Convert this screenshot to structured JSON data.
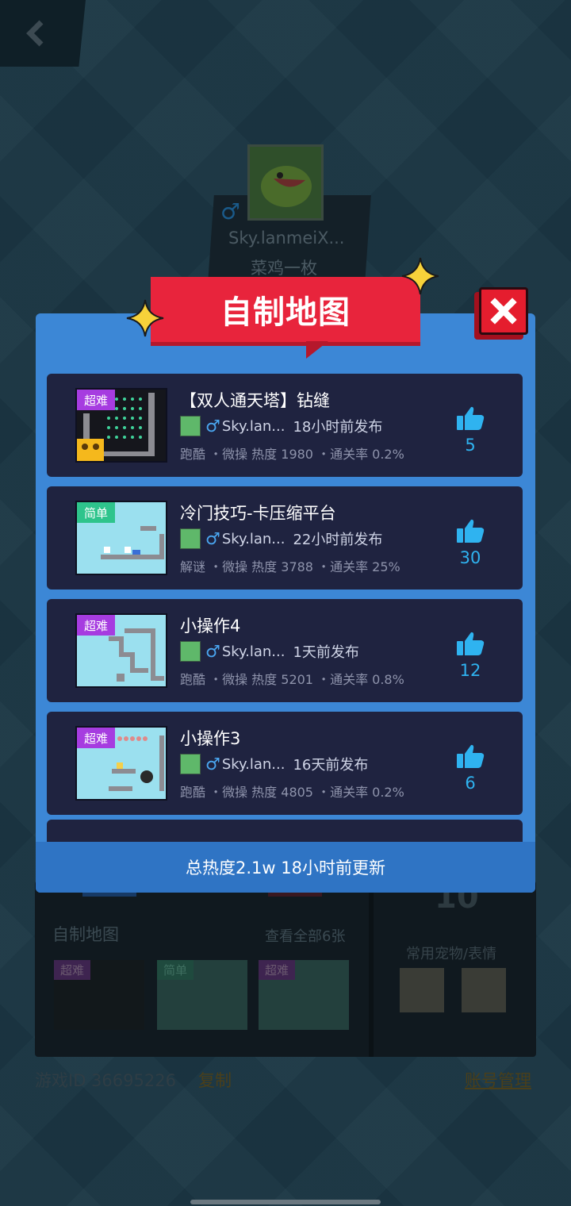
{
  "background": {
    "profile": {
      "gender": "♂",
      "name": "Sky.lanmeiX...",
      "title": "菜鸡一枚"
    },
    "custom_maps_section": {
      "title": "自制地图",
      "view_all": "查看全部6张",
      "thumbs": [
        {
          "badge": "超难"
        },
        {
          "badge": "简单"
        },
        {
          "badge": "超难"
        }
      ]
    },
    "big_number": "10",
    "pets_label": "常用宠物/表情",
    "game_id": "游戏ID 36695226",
    "copy_label": "复制",
    "account_label": "账号管理"
  },
  "modal": {
    "title": "自制地图",
    "footer": "总热度2.1w 18小时前更新",
    "maps": [
      {
        "difficulty": "超难",
        "difficulty_color": "#a63ce0",
        "title": "【双人通天塔】钻缝",
        "gender": "♂",
        "author": "Sky.lan...",
        "time": "18小时前发布",
        "stats": "跑酷 ・微操 热度 1980 ・通关率 0.2%",
        "likes": "5"
      },
      {
        "difficulty": "简单",
        "difficulty_color": "#2ec48c",
        "title": "冷门技巧-卡压缩平台",
        "gender": "♂",
        "author": "Sky.lan...",
        "time": "22小时前发布",
        "stats": "解谜 ・微操 热度 3788 ・通关率 25%",
        "likes": "30"
      },
      {
        "difficulty": "超难",
        "difficulty_color": "#a63ce0",
        "title": "小操作4",
        "gender": "♂",
        "author": "Sky.lan...",
        "time": "1天前发布",
        "stats": "跑酷 ・微操 热度 5201 ・通关率 0.8%",
        "likes": "12"
      },
      {
        "difficulty": "超难",
        "difficulty_color": "#a63ce0",
        "title": "小操作3",
        "gender": "♂",
        "author": "Sky.lan...",
        "time": "16天前发布",
        "stats": "跑酷 ・微操 热度 4805 ・通关率 0.2%",
        "likes": "6"
      }
    ]
  },
  "icons": {
    "back": "chevron-left-icon",
    "close": "close-x-icon",
    "like": "thumbs-up-icon",
    "star": "sparkle-star-icon"
  }
}
